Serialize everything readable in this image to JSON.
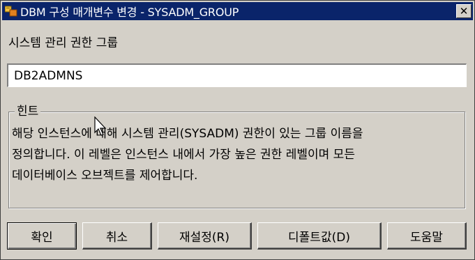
{
  "window": {
    "title": "DBM 구성 매개변수 변경 - SYSADM_GROUP",
    "close_glyph": "✕",
    "app_icon": "db2-config-icon"
  },
  "field": {
    "label": "시스템 관리 권한 그룹",
    "value": "DB2ADMNS"
  },
  "hint": {
    "legend": "힌트",
    "text": "해당 인스턴스에 대해 시스템 관리(SYSADM) 권한이 있는 그룹 이름을\n정의합니다. 이 레벨은 인스턴스 내에서 가장 높은 권한 레벨이며 모든\n데이터베이스 오브젝트를 제어합니다."
  },
  "buttons": {
    "ok": "확인",
    "cancel": "취소",
    "reset": "재설정(R)",
    "default": "디폴트값(D)",
    "help": "도움말"
  },
  "colors": {
    "titlebar": "#0a246a",
    "dialog_face": "#d4d0c8"
  }
}
